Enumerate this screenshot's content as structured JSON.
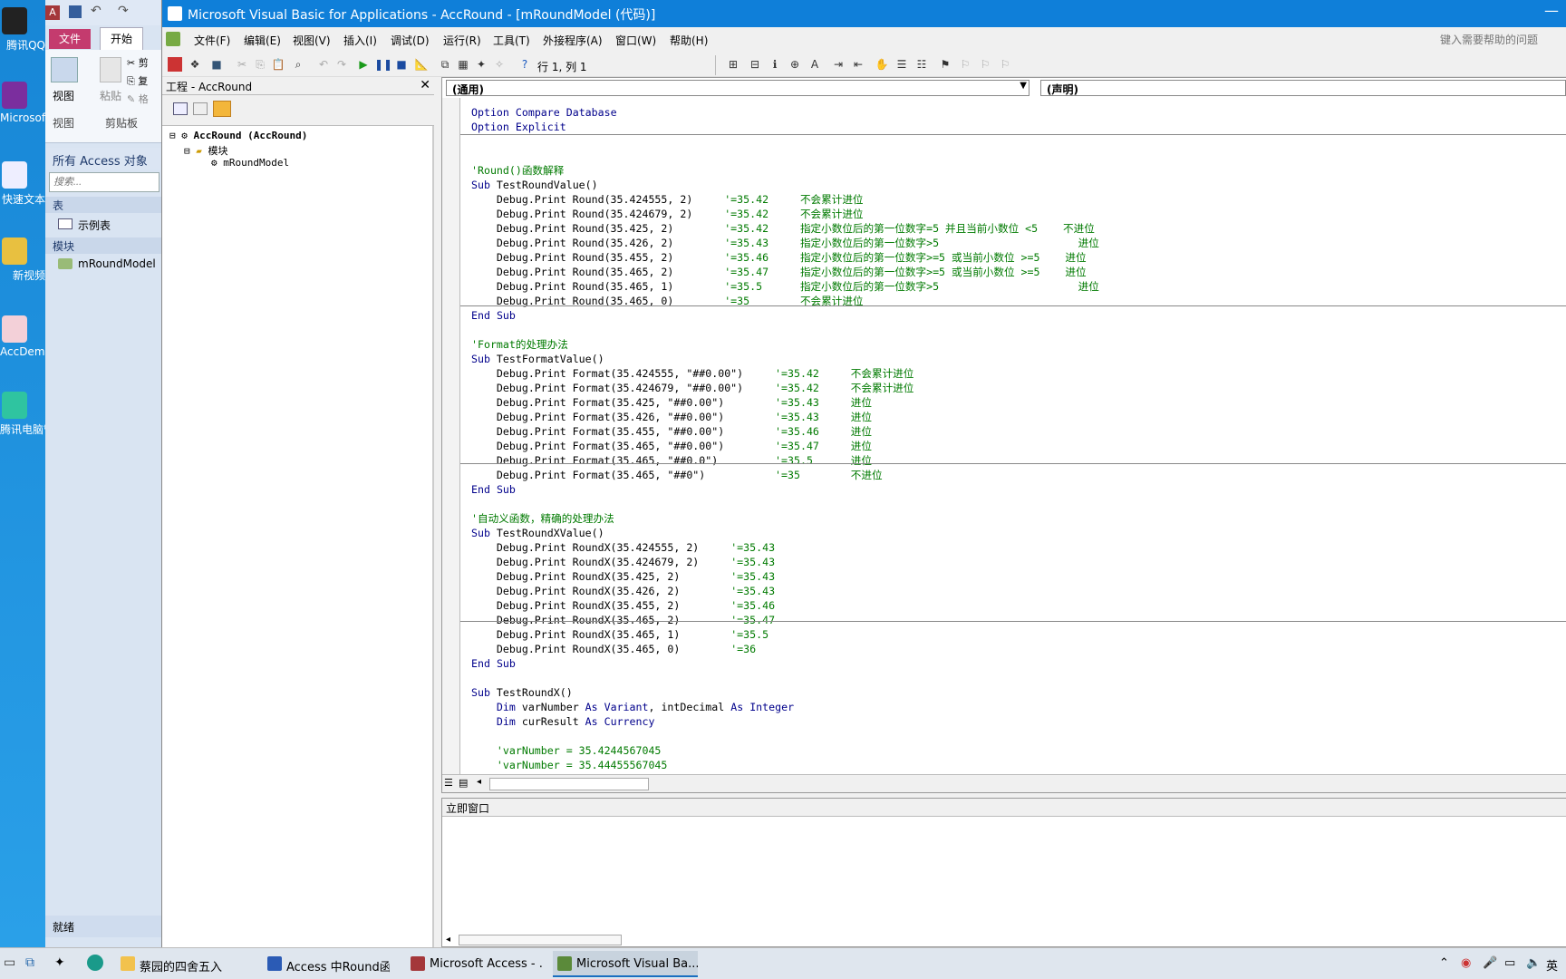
{
  "desktop": {
    "icons": [
      "腾讯QQ",
      "Microsoft OneNot...",
      "快速文本",
      "新视频",
      "AccDemo",
      "腾讯电脑管家"
    ]
  },
  "access": {
    "file_tab": "文件",
    "home_tab": "开始",
    "view_label": "视图",
    "paste_label": "粘贴",
    "view_group": "视图",
    "clipboard_group": "剪贴板",
    "cut_label": "剪",
    "copy_label": "复",
    "format_label": "格",
    "nav_header": "所有 Access 对象",
    "search_placeholder": "搜索...",
    "group_tables": "表",
    "table_item": "示例表",
    "group_modules": "模块",
    "module_item": "mRoundModel",
    "status": "就绪"
  },
  "vbe": {
    "title": "Microsoft Visual Basic for Applications - AccRound - [mRoundModel (代码)]",
    "menus": [
      "文件(F)",
      "编辑(E)",
      "视图(V)",
      "插入(I)",
      "调试(D)",
      "运行(R)",
      "工具(T)",
      "外接程序(A)",
      "窗口(W)",
      "帮助(H)"
    ],
    "help_placeholder": "键入需要帮助的问题",
    "cursor_pos": "行 1, 列 1",
    "project_title": "工程 - AccRound",
    "tree_root": "AccRound (AccRound)",
    "tree_folder": "模块",
    "tree_module": "mRoundModel",
    "combo_left": "(通用)",
    "combo_right": "(声明)",
    "immediate_title": "立即窗口"
  },
  "code": {
    "block1": [
      {
        "t": "Option Compare Database",
        "s": "k"
      },
      {
        "t": "Option Explicit",
        "s": "k"
      }
    ],
    "block2": [
      {
        "t": "",
        "s": ""
      },
      {
        "t": "",
        "s": ""
      },
      {
        "t": "'Round()函数解释",
        "s": "c"
      },
      {
        "t": "Sub TestRoundValue()",
        "s": ""
      },
      {
        "t": "    Debug.Print Round(35.424555, 2)     '=35.42     不会累计进位",
        "s": ""
      },
      {
        "t": "    Debug.Print Round(35.424679, 2)     '=35.42     不会累计进位",
        "s": ""
      },
      {
        "t": "    Debug.Print Round(35.425, 2)        '=35.42     指定小数位后的第一位数字=5 并且当前小数位 <5    不进位",
        "s": ""
      },
      {
        "t": "    Debug.Print Round(35.426, 2)        '=35.43     指定小数位后的第一位数字>5                      进位",
        "s": ""
      },
      {
        "t": "    Debug.Print Round(35.455, 2)        '=35.46     指定小数位后的第一位数字>=5 或当前小数位 >=5    进位",
        "s": ""
      },
      {
        "t": "    Debug.Print Round(35.465, 2)        '=35.47     指定小数位后的第一位数字>=5 或当前小数位 >=5    进位",
        "s": ""
      },
      {
        "t": "    Debug.Print Round(35.465, 1)        '=35.5      指定小数位后的第一位数字>5                      进位",
        "s": ""
      },
      {
        "t": "    Debug.Print Round(35.465, 0)        '=35        不会累计进位",
        "s": ""
      },
      {
        "t": "End Sub",
        "s": ""
      }
    ],
    "block3": [
      {
        "t": "",
        "s": ""
      },
      {
        "t": "'Format的处理办法",
        "s": "c"
      },
      {
        "t": "Sub TestFormatValue()",
        "s": ""
      },
      {
        "t": "    Debug.Print Format(35.424555, \"##0.00\")     '=35.42     不会累计进位",
        "s": ""
      },
      {
        "t": "    Debug.Print Format(35.424679, \"##0.00\")     '=35.42     不会累计进位",
        "s": ""
      },
      {
        "t": "    Debug.Print Format(35.425, \"##0.00\")        '=35.43     进位",
        "s": ""
      },
      {
        "t": "    Debug.Print Format(35.426, \"##0.00\")        '=35.43     进位",
        "s": ""
      },
      {
        "t": "    Debug.Print Format(35.455, \"##0.00\")        '=35.46     进位",
        "s": ""
      },
      {
        "t": "    Debug.Print Format(35.465, \"##0.00\")        '=35.47     进位",
        "s": ""
      },
      {
        "t": "    Debug.Print Format(35.465, \"##0.0\")         '=35.5      进位",
        "s": ""
      },
      {
        "t": "    Debug.Print Format(35.465, \"##0\")           '=35        不进位",
        "s": ""
      },
      {
        "t": "End Sub",
        "s": ""
      }
    ],
    "block4": [
      {
        "t": "",
        "s": ""
      },
      {
        "t": "'自动义函数，精确的处理办法",
        "s": "c"
      },
      {
        "t": "Sub TestRoundXValue()",
        "s": ""
      },
      {
        "t": "    Debug.Print RoundX(35.424555, 2)     '=35.43",
        "s": ""
      },
      {
        "t": "    Debug.Print RoundX(35.424679, 2)     '=35.43",
        "s": ""
      },
      {
        "t": "    Debug.Print RoundX(35.425, 2)        '=35.43",
        "s": ""
      },
      {
        "t": "    Debug.Print RoundX(35.426, 2)        '=35.43",
        "s": ""
      },
      {
        "t": "    Debug.Print RoundX(35.455, 2)        '=35.46",
        "s": ""
      },
      {
        "t": "    Debug.Print RoundX(35.465, 2)        '=35.47",
        "s": ""
      },
      {
        "t": "    Debug.Print RoundX(35.465, 1)        '=35.5",
        "s": ""
      },
      {
        "t": "    Debug.Print RoundX(35.465, 0)        '=36",
        "s": ""
      },
      {
        "t": "End Sub",
        "s": ""
      }
    ],
    "block5": [
      {
        "t": "",
        "s": ""
      },
      {
        "t": "Sub TestRoundX()",
        "s": ""
      },
      {
        "t": "    Dim varNumber As Variant, intDecimal As Integer",
        "s": ""
      },
      {
        "t": "    Dim curResult As Currency",
        "s": ""
      },
      {
        "t": "",
        "s": ""
      },
      {
        "t": "    'varNumber = 35.4244567045",
        "s": "c"
      },
      {
        "t": "    'varNumber = 35.44455567045",
        "s": "c"
      }
    ]
  },
  "taskbar": {
    "apps": [
      "蔡园的四舍五入",
      "Access 中Round函...",
      "Microsoft Access - ...",
      "Microsoft Visual Ba..."
    ],
    "ime": "英"
  },
  "colors": {
    "title_bar": "#0f7fd9",
    "keyword": "#00008b",
    "comment": "#007a00",
    "file_tab": "#c43b6e"
  }
}
